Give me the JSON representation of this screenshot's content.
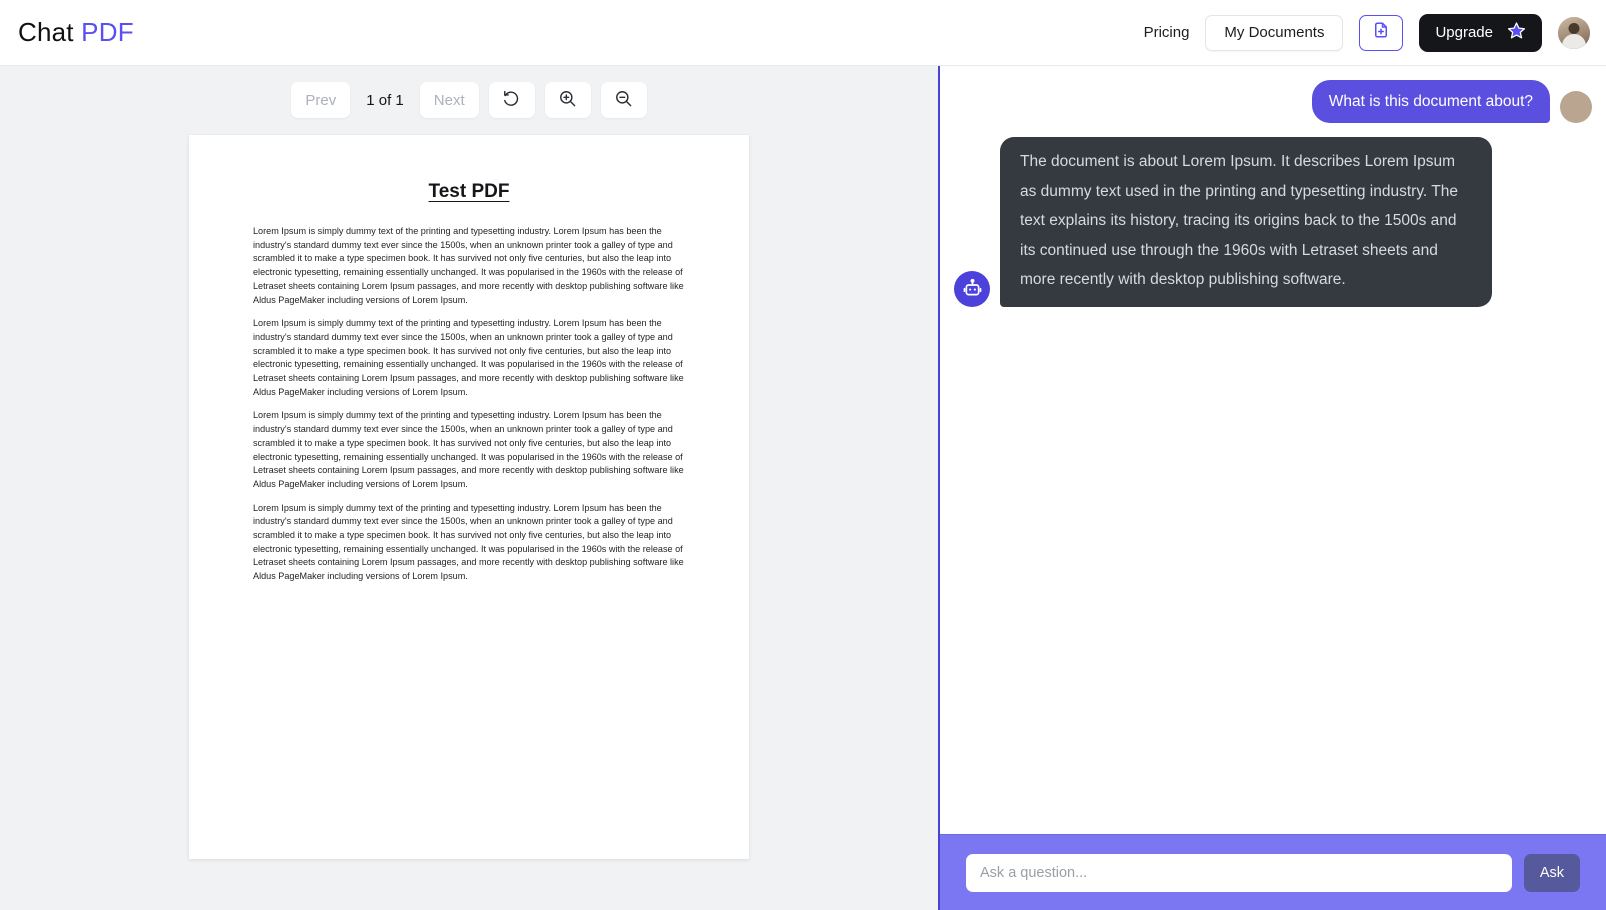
{
  "header": {
    "brand_first": "Chat",
    "brand_second": "PDF",
    "pricing_label": "Pricing",
    "my_documents_label": "My Documents",
    "upload_icon": "add-document-icon",
    "upgrade_label": "Upgrade",
    "upgrade_icon": "star-icon",
    "avatar_icon": "user-avatar",
    "accent_color": "#5a4ff3",
    "upgrade_bg": "#15161a"
  },
  "pdf_viewer": {
    "toolbar": {
      "prev_label": "Prev",
      "page_indicator": "1 of 1",
      "next_label": "Next",
      "rotate_icon": "rotate-ccw-icon",
      "zoom_in_icon": "zoom-in-icon",
      "zoom_out_icon": "zoom-out-icon"
    },
    "document": {
      "title": "Test PDF",
      "paragraphs": [
        "Lorem Ipsum is simply dummy text of the printing and typesetting industry. Lorem Ipsum has been the industry's standard dummy text ever since the 1500s, when an unknown printer took a galley of type and scrambled it to make a type specimen book. It has survived not only five centuries, but also the leap into electronic typesetting, remaining essentially unchanged. It was popularised in the 1960s with the release of Letraset sheets containing Lorem Ipsum passages, and more recently with desktop publishing software like Aldus PageMaker including versions of Lorem Ipsum.",
        "Lorem Ipsum is simply dummy text of the printing and typesetting industry. Lorem Ipsum has been the industry's standard dummy text ever since the 1500s, when an unknown printer took a galley of type and scrambled it to make a type specimen book. It has survived not only five centuries, but also the leap into electronic typesetting, remaining essentially unchanged. It was popularised in the 1960s with the release of Letraset sheets containing Lorem Ipsum passages, and more recently with desktop publishing software like Aldus PageMaker including versions of Lorem Ipsum.",
        "Lorem Ipsum is simply dummy text of the printing and typesetting industry. Lorem Ipsum has been the industry's standard dummy text ever since the 1500s, when an unknown printer took a galley of type and scrambled it to make a type specimen book. It has survived not only five centuries, but also the leap into electronic typesetting, remaining essentially unchanged. It was popularised in the 1960s with the release of Letraset sheets containing Lorem Ipsum passages, and more recently with desktop publishing software like Aldus PageMaker including versions of Lorem Ipsum.",
        "Lorem Ipsum is simply dummy text of the printing and typesetting industry. Lorem Ipsum has been the industry's standard dummy text ever since the 1500s, when an unknown printer took a galley of type and scrambled it to make a type specimen book. It has survived not only five centuries, but also the leap into electronic typesetting, remaining essentially unchanged. It was popularised in the 1960s with the release of Letraset sheets containing Lorem Ipsum passages, and more recently with desktop publishing software like Aldus PageMaker including versions of Lorem Ipsum."
      ]
    }
  },
  "chat": {
    "messages": [
      {
        "role": "user",
        "text": "What is this document about?",
        "avatar_icon": "user-avatar",
        "bubble_color": "#5b4fe0"
      },
      {
        "role": "assistant",
        "text": "The document is about Lorem Ipsum. It describes Lorem Ipsum as dummy text used in the printing and typesetting industry. The text explains its history, tracing its origins back to the 1500s and its continued use through the 1960s with Letraset sheets and more recently with desktop publishing software.",
        "avatar_icon": "robot-icon",
        "bubble_color": "#343a40"
      }
    ],
    "composer": {
      "placeholder": "Ask a question...",
      "value": "",
      "ask_label": "Ask",
      "bar_color": "#7b76f2"
    }
  }
}
